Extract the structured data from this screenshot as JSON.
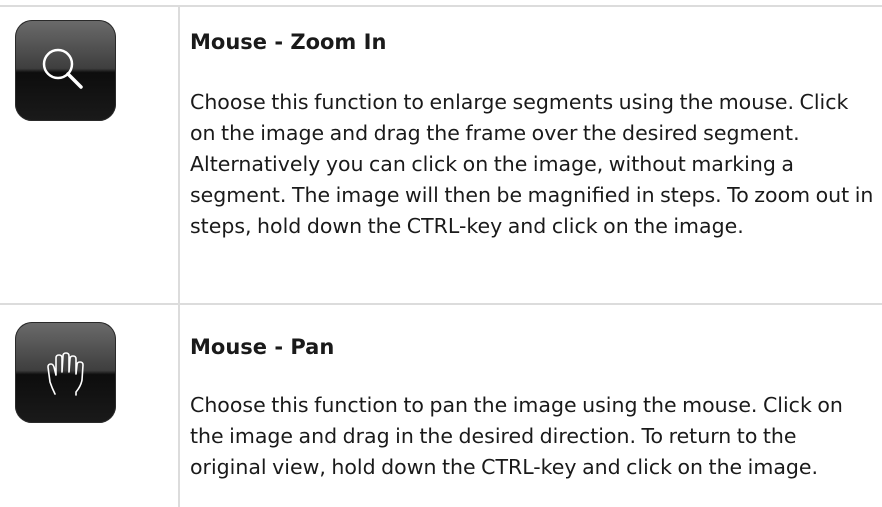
{
  "rows": [
    {
      "icon": "zoom-in-magnifier-icon",
      "title": "Mouse - Zoom In",
      "desc": "Choose this function to enlarge segments using the mouse. Click on the image and drag the frame over the desired segment. Alternatively you can click on the image, without marking a segment. The image will then be magnified in steps. To zoom out in steps, hold down the CTRL-key and click on the image."
    },
    {
      "icon": "pan-hand-icon",
      "title": "Mouse - Pan",
      "desc": "Choose this function to pan the image using the mouse. Click on the image and drag in the desired direction. To return to the original view, hold down the CTRL-key and click on the image."
    }
  ],
  "colors": {
    "border": "#dcdcdc",
    "text": "#1a1a1a",
    "button_dark": "#1a1a1a"
  }
}
